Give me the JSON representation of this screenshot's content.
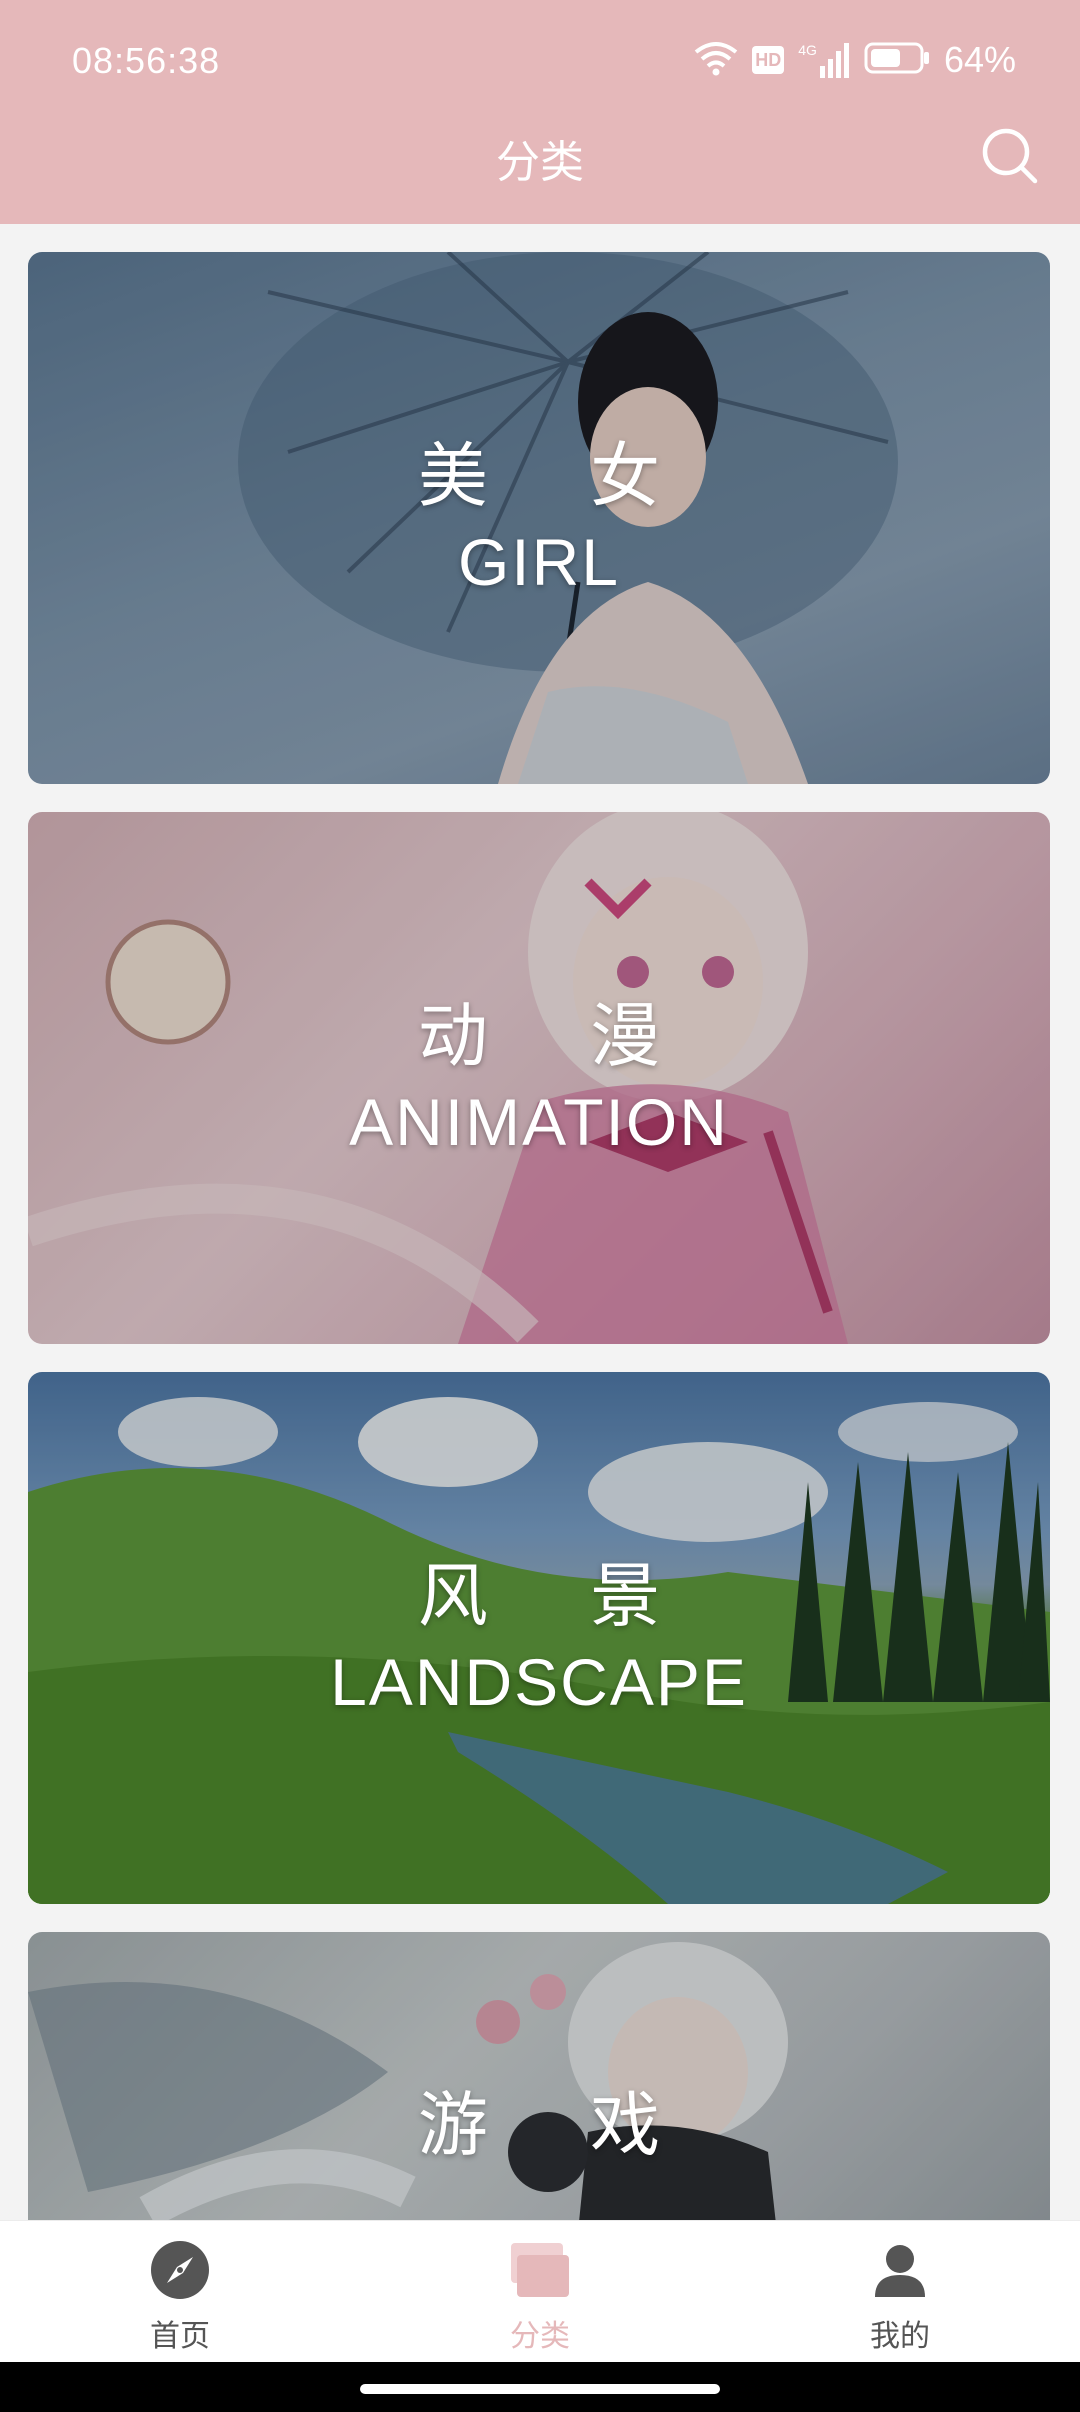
{
  "status_bar": {
    "time": "08:56:38",
    "hd_label": "HD",
    "network_label": "4G",
    "battery_percent": "64%",
    "battery_level": 0.64
  },
  "header": {
    "title": "分类",
    "background_color": "#e5b8ba"
  },
  "categories": [
    {
      "title_cn": "美 女",
      "title_en": "GIRL"
    },
    {
      "title_cn": "动 漫",
      "title_en": "ANIMATION"
    },
    {
      "title_cn": "风 景",
      "title_en": "LANDSCAPE"
    },
    {
      "title_cn": "游 戏",
      "title_en": ""
    }
  ],
  "bottom_nav": {
    "items": [
      {
        "label": "首页",
        "icon": "compass-icon",
        "active": false
      },
      {
        "label": "分类",
        "icon": "category-icon",
        "active": true
      },
      {
        "label": "我的",
        "icon": "person-icon",
        "active": false
      }
    ],
    "active_color": "#e5b8ba",
    "inactive_color": "#555555"
  }
}
